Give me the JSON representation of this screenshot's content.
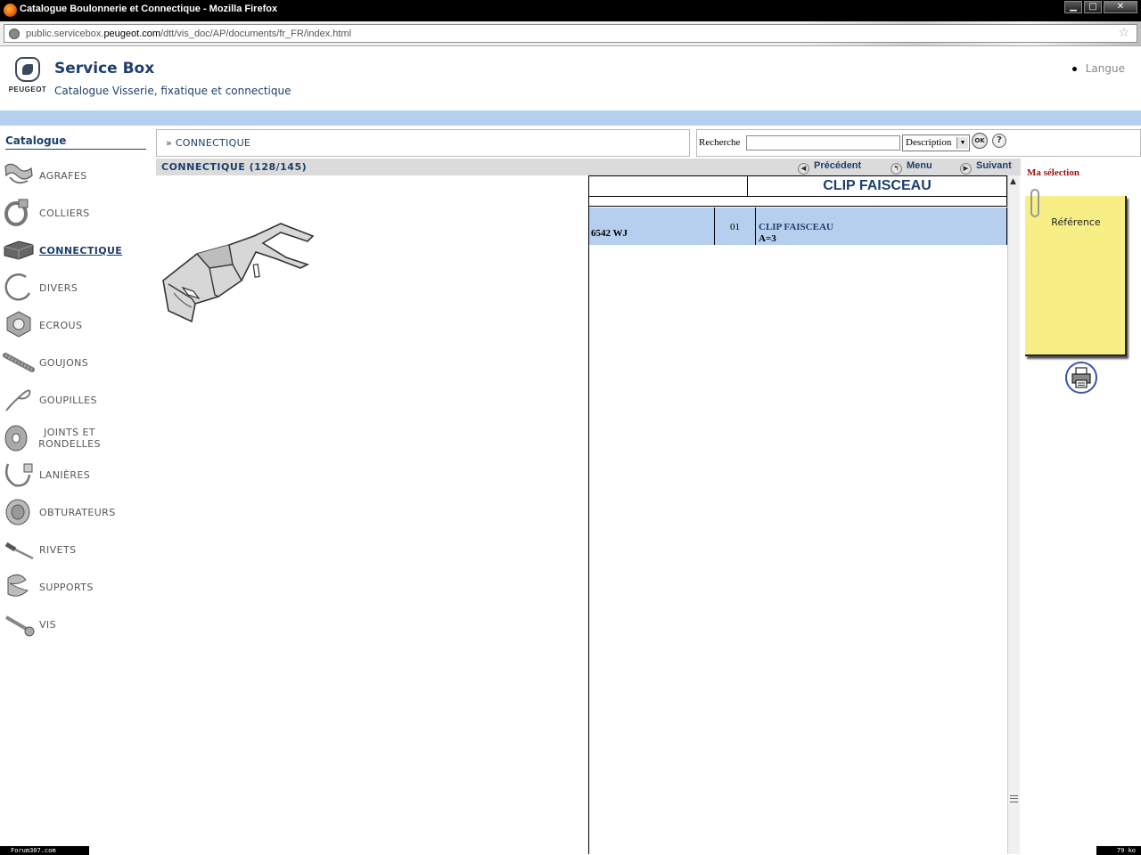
{
  "window": {
    "title": "Catalogue Boulonnerie et Connectique - Mozilla Firefox",
    "buttons": {
      "minimize": "▁",
      "maximize": "□",
      "close": "✕"
    }
  },
  "urlbar": {
    "url_prefix": "public.servicebox.",
    "url_domain": "peugeot.com",
    "url_suffix": "/dtt/vis_doc/AP/documents/fr_FR/index.html"
  },
  "header": {
    "brand": "PEUGEOT",
    "title": "Service Box",
    "subtitle": "Catalogue Visserie, fixatique et connectique",
    "language_link": "Langue"
  },
  "sidebar": {
    "title": "Catalogue",
    "items": [
      {
        "label": "AGRAFES",
        "icon": "clip-icon"
      },
      {
        "label": "COLLIERS",
        "icon": "hose-clamp-icon"
      },
      {
        "label": "CONNECTIQUE",
        "icon": "connector-icon",
        "active": true
      },
      {
        "label": "DIVERS",
        "icon": "ring-icon"
      },
      {
        "label": "ECROUS",
        "icon": "nut-icon"
      },
      {
        "label": "GOUJONS",
        "icon": "stud-icon"
      },
      {
        "label": "GOUPILLES",
        "icon": "pin-icon"
      },
      {
        "label": "JOINTS ET RONDELLES",
        "icon": "washer-icon"
      },
      {
        "label": "LANIÈRES",
        "icon": "strap-icon"
      },
      {
        "label": "OBTURATEURS",
        "icon": "plug-icon"
      },
      {
        "label": "RIVETS",
        "icon": "rivet-icon"
      },
      {
        "label": "SUPPORTS",
        "icon": "support-icon"
      },
      {
        "label": "VIS",
        "icon": "screw-icon"
      }
    ]
  },
  "breadcrumb": {
    "text": "» CONNECTIQUE"
  },
  "search": {
    "label": "Recherche",
    "value": "",
    "select_value": "Description",
    "ok_label": "OK",
    "help_label": "?"
  },
  "section": {
    "title": "CONNECTIQUE (128/145)",
    "prev_label": "Précédent",
    "menu_label": "Menu",
    "next_label": "Suivant"
  },
  "table": {
    "title": "CLIP FAISCEAU",
    "rows": [
      {
        "reference": "6542 WJ",
        "index": "01",
        "description": "CLIP FAISCEAU",
        "detail": "A=3"
      }
    ]
  },
  "selection": {
    "title": "Ma sélection",
    "note_label": "Référence"
  },
  "status": {
    "left": "Forum307.com",
    "right": "79 ko"
  },
  "colors": {
    "brand_blue": "#1d3f6b",
    "band_blue": "#b7cfee",
    "selection_red": "#9b1010",
    "note_yellow": "#f7ef86"
  }
}
